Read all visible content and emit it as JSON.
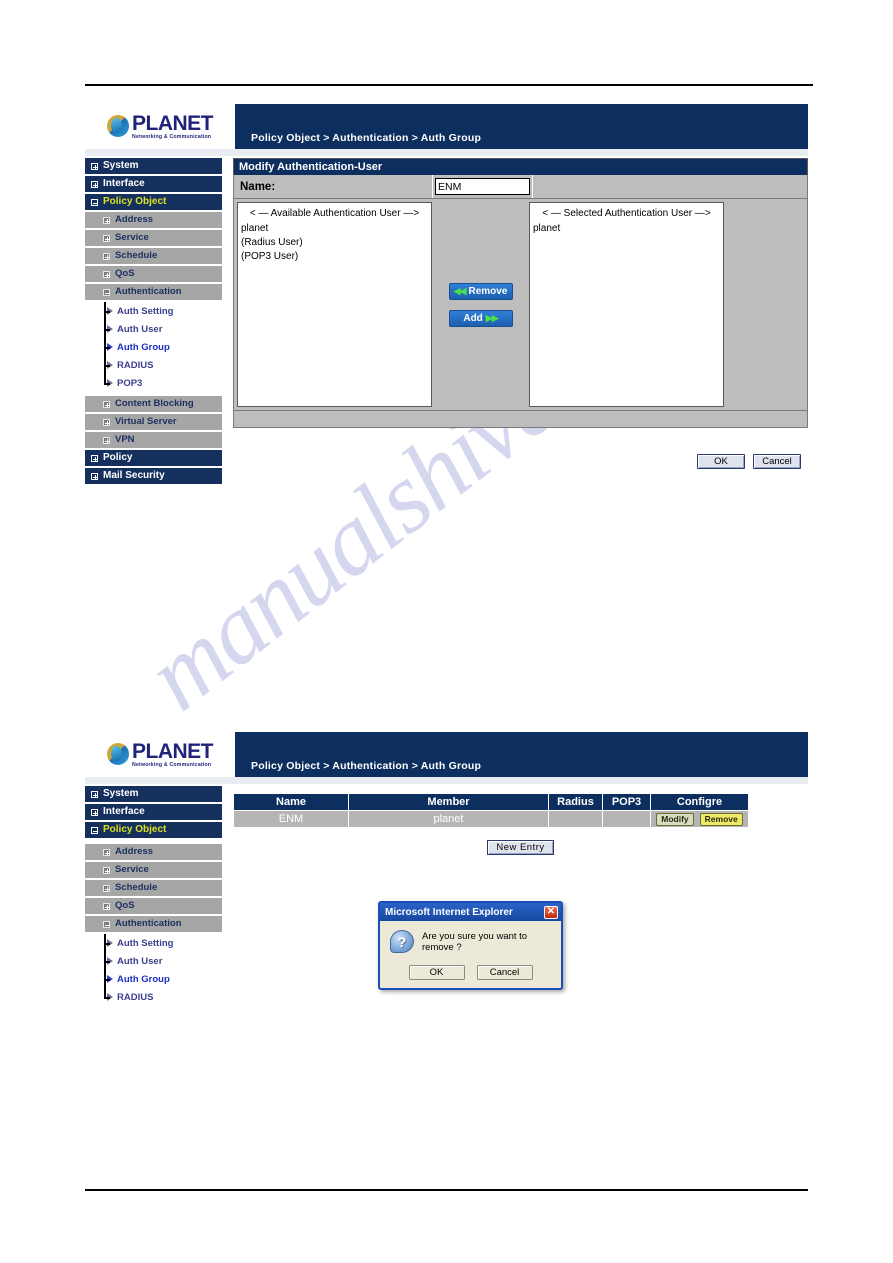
{
  "watermark": {
    "text": "manualshive.com"
  },
  "header": {
    "logo_name": "PLANET",
    "logo_tagline": "Networking & Communication",
    "breadcrumb": "Policy Object > Authentication > Auth Group"
  },
  "sidebar": {
    "top_items": [
      {
        "label": "System"
      },
      {
        "label": "Interface"
      },
      {
        "label": "Policy Object"
      }
    ],
    "sub_items": [
      {
        "label": "Address"
      },
      {
        "label": "Service"
      },
      {
        "label": "Schedule"
      },
      {
        "label": "QoS"
      },
      {
        "label": "Authentication"
      }
    ],
    "leaf_items": [
      {
        "label": "Auth Setting"
      },
      {
        "label": "Auth User"
      },
      {
        "label": "Auth Group"
      },
      {
        "label": "RADIUS"
      },
      {
        "label": "POP3"
      }
    ],
    "sub_items_2": [
      {
        "label": "Content Blocking"
      },
      {
        "label": "Virtual Server"
      },
      {
        "label": "VPN"
      }
    ],
    "bottom_items": [
      {
        "label": "Policy"
      },
      {
        "label": "Mail Security"
      }
    ]
  },
  "sidebar2": {
    "top_items": [
      {
        "label": "System"
      },
      {
        "label": "Interface"
      },
      {
        "label": "Policy Object"
      }
    ],
    "sub_items": [
      {
        "label": "Address"
      },
      {
        "label": "Service"
      },
      {
        "label": "Schedule"
      },
      {
        "label": "QoS"
      },
      {
        "label": "Authentication"
      }
    ],
    "leaf_items": [
      {
        "label": "Auth Setting"
      },
      {
        "label": "Auth User"
      },
      {
        "label": "Auth Group"
      },
      {
        "label": "RADIUS"
      }
    ]
  },
  "modify_panel": {
    "title": "Modify Authentication-User",
    "name_label": "Name:",
    "name_value": "ENM",
    "available_header": "< — Available Authentication User —>",
    "available_items": [
      "planet",
      "(Radius User)",
      "(POP3 User)"
    ],
    "selected_header": "< — Selected Authentication User —>",
    "selected_items": [
      "planet"
    ],
    "remove_button": "Remove",
    "add_button": "Add",
    "ok_button": "OK",
    "cancel_button": "Cancel"
  },
  "list_panel": {
    "columns": [
      "Name",
      "Member",
      "Radius",
      "POP3",
      "Configre"
    ],
    "rows": [
      {
        "name": "ENM",
        "member": "planet",
        "radius": "",
        "pop3": "",
        "modify_label": "Modify",
        "remove_label": "Remove"
      }
    ],
    "new_entry_button": "New Entry"
  },
  "dialog": {
    "title": "Microsoft Internet Explorer",
    "close_glyph": "✕",
    "icon_glyph": "?",
    "message": "Are you sure you want to remove ?",
    "ok_button": "OK",
    "cancel_button": "Cancel"
  },
  "colors": {
    "navy": "#0d2f60",
    "sidebar_navy": "#16305e",
    "sidebar_gray": "#a6a6a6",
    "accent_yellow": "#d9e021",
    "button_blue": "#2f7fd6",
    "watermark": "#9aa2d8"
  }
}
